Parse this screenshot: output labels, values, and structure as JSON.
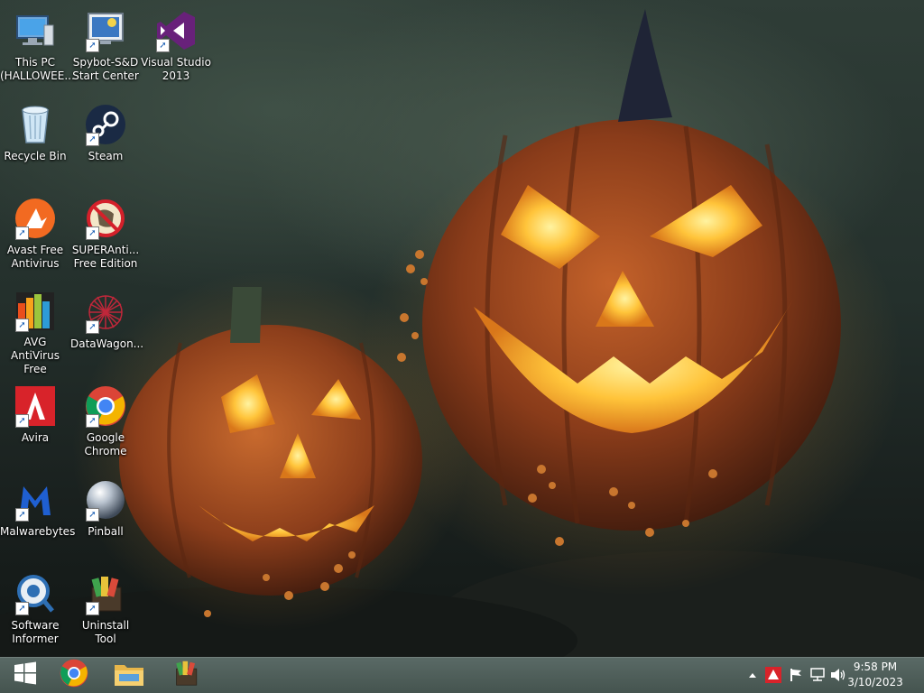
{
  "desktop": {
    "icons": [
      {
        "label": "This PC\n(HALLOWEE...",
        "icon": "computer-icon"
      },
      {
        "label": "Spybot-S&D\nStart Center",
        "icon": "spybot-icon"
      },
      {
        "label": "Visual Studio\n2013",
        "icon": "visual-studio-icon"
      },
      {
        "label": "Recycle Bin",
        "icon": "recycle-bin-icon"
      },
      {
        "label": "Steam",
        "icon": "steam-icon"
      },
      {
        "label": "Avast Free\nAntivirus",
        "icon": "avast-icon"
      },
      {
        "label": "SUPERAnti...\nFree Edition",
        "icon": "superantispyware-icon"
      },
      {
        "label": "AVG AntiVirus\nFree",
        "icon": "avg-icon"
      },
      {
        "label": "DataWagon...",
        "icon": "datawagon-icon"
      },
      {
        "label": "Avira",
        "icon": "avira-icon"
      },
      {
        "label": "Google\nChrome",
        "icon": "chrome-icon"
      },
      {
        "label": "Malwarebytes",
        "icon": "malwarebytes-icon"
      },
      {
        "label": "Pinball",
        "icon": "pinball-icon"
      },
      {
        "label": "Software\nInformer",
        "icon": "software-informer-icon"
      },
      {
        "label": "Uninstall Tool",
        "icon": "uninstall-tool-icon"
      }
    ]
  },
  "taskbar": {
    "start": "windows-start-icon",
    "pinned": [
      "chrome-icon",
      "file-explorer-icon",
      "uninstall-tool-icon"
    ],
    "tray": [
      "chevron-up-icon",
      "security-alert-icon",
      "flag-icon",
      "network-icon",
      "volume-icon"
    ],
    "time": "9:58 PM",
    "date": "3/10/2023"
  }
}
